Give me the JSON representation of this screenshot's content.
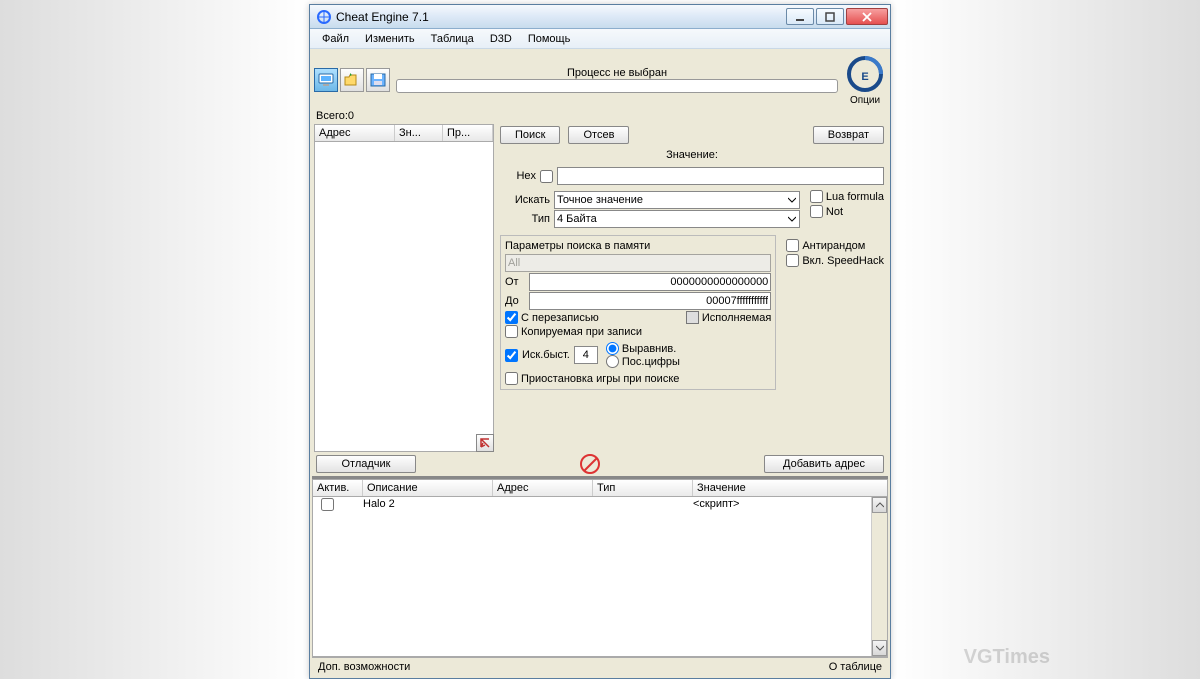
{
  "window": {
    "title": "Cheat Engine 7.1"
  },
  "menu": {
    "file": "Файл",
    "edit": "Изменить",
    "table": "Таблица",
    "d3d": "D3D",
    "help": "Помощь"
  },
  "toolbar": {
    "process_none": "Процесс не выбран",
    "options": "Опции"
  },
  "total": {
    "label": "Всего:",
    "value": "0"
  },
  "left_list": {
    "cols": {
      "addr": "Адрес",
      "val": "Зн...",
      "prev": "Пр..."
    }
  },
  "search": {
    "btn_search": "Поиск",
    "btn_filter": "Отсев",
    "btn_return": "Возврат",
    "value_label": "Значение:",
    "hex_label": "Hex",
    "scan_label": "Искать",
    "scan_type": "Точное значение",
    "type_label": "Тип",
    "value_type": "4 Байта",
    "lua": "Lua formula",
    "not": "Not",
    "mem_title": "Параметры поиска в памяти",
    "mem_all": "All",
    "from_label": "От",
    "from_val": "0000000000000000",
    "to_label": "До",
    "to_val": "00007fffffffffff",
    "writable": "С перезаписью",
    "executable": "Исполняемая",
    "copyonwrite": "Копируемая при записи",
    "antirandom": "Антирандом",
    "speedhack": "Вкл. SpeedHack",
    "fast_label": "Иск.быст.",
    "fast_val": "4",
    "align": "Выравнив.",
    "lastdigits": "Пос.цифры",
    "pause": "Приостановка игры при поиске"
  },
  "mid": {
    "debugger": "Отладчик",
    "add_addr": "Добавить адрес"
  },
  "table": {
    "cols": {
      "active": "Актив.",
      "desc": "Описание",
      "addr": "Адрес",
      "type": "Тип",
      "value": "Значение"
    },
    "rows": [
      {
        "active": false,
        "desc": "Halo 2",
        "addr": "",
        "type": "",
        "value": "<скрипт>"
      }
    ]
  },
  "status": {
    "left": "Доп. возможности",
    "right": "О таблице"
  },
  "watermark": "VGTimes"
}
